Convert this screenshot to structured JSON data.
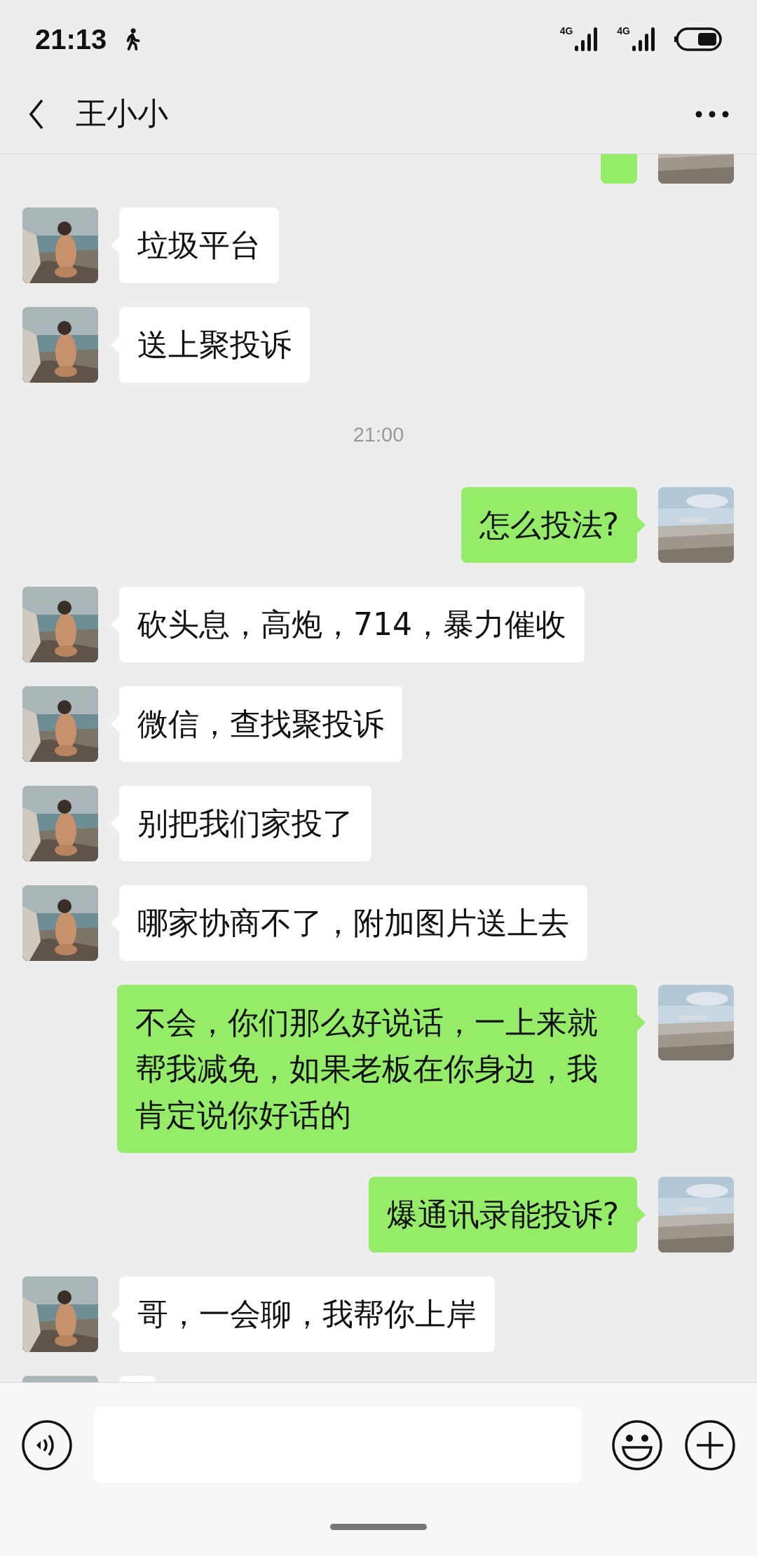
{
  "status_bar": {
    "time": "21:13",
    "networks": [
      "4G",
      "4G"
    ]
  },
  "header": {
    "title": "王小小"
  },
  "messages": [
    {
      "kind": "sent"
    },
    {
      "kind": "received",
      "text": "垃圾平台"
    },
    {
      "kind": "received",
      "text": "送上聚投诉"
    },
    {
      "kind": "time",
      "text": "21:00"
    },
    {
      "kind": "sent",
      "text": "怎么投法?"
    },
    {
      "kind": "received",
      "text": "砍头息，高炮，714，暴力催收"
    },
    {
      "kind": "received",
      "text": "微信，查找聚投诉"
    },
    {
      "kind": "received",
      "text": "别把我们家投了"
    },
    {
      "kind": "received",
      "text": "哪家协商不了，附加图片送上去"
    },
    {
      "kind": "sent",
      "text": "不会，你们那么好说话，一上来就帮我减免，如果老板在你身边，我肯定说你好话的"
    },
    {
      "kind": "sent",
      "text": "爆通讯录能投诉?"
    },
    {
      "kind": "received",
      "text": "哥，一会聊，我帮你上岸"
    },
    {
      "kind": "received"
    }
  ]
}
